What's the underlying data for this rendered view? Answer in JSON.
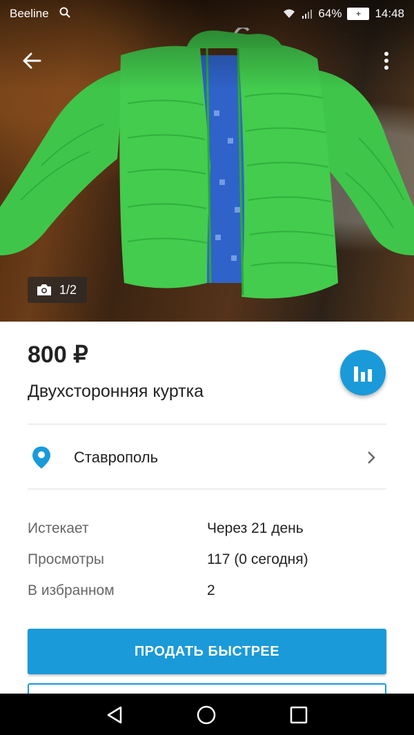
{
  "status_bar": {
    "carrier": "Beeline",
    "battery": "64%",
    "time": "14:48",
    "icons": [
      "search-icon",
      "wifi-icon",
      "signal-icon",
      "battery-charging-icon"
    ]
  },
  "gallery": {
    "counter": "1/2",
    "icons": [
      "back-arrow-icon",
      "more-vertical-icon",
      "camera-icon"
    ]
  },
  "listing": {
    "price": "800 ₽",
    "title": "Двухсторонняя куртка",
    "location": "Ставрополь"
  },
  "details": [
    {
      "label": "Истекает",
      "value": "Через 21 день"
    },
    {
      "label": "Просмотры",
      "value": "117 (0 сегодня)"
    },
    {
      "label": "В избранном",
      "value": "2"
    }
  ],
  "actions": {
    "sell_faster": "ПРОДАТЬ БЫСТРЕЕ"
  },
  "colors": {
    "accent": "#1a9ad9",
    "pin": "#1a9ad9",
    "jacket": "#3fc64a"
  }
}
